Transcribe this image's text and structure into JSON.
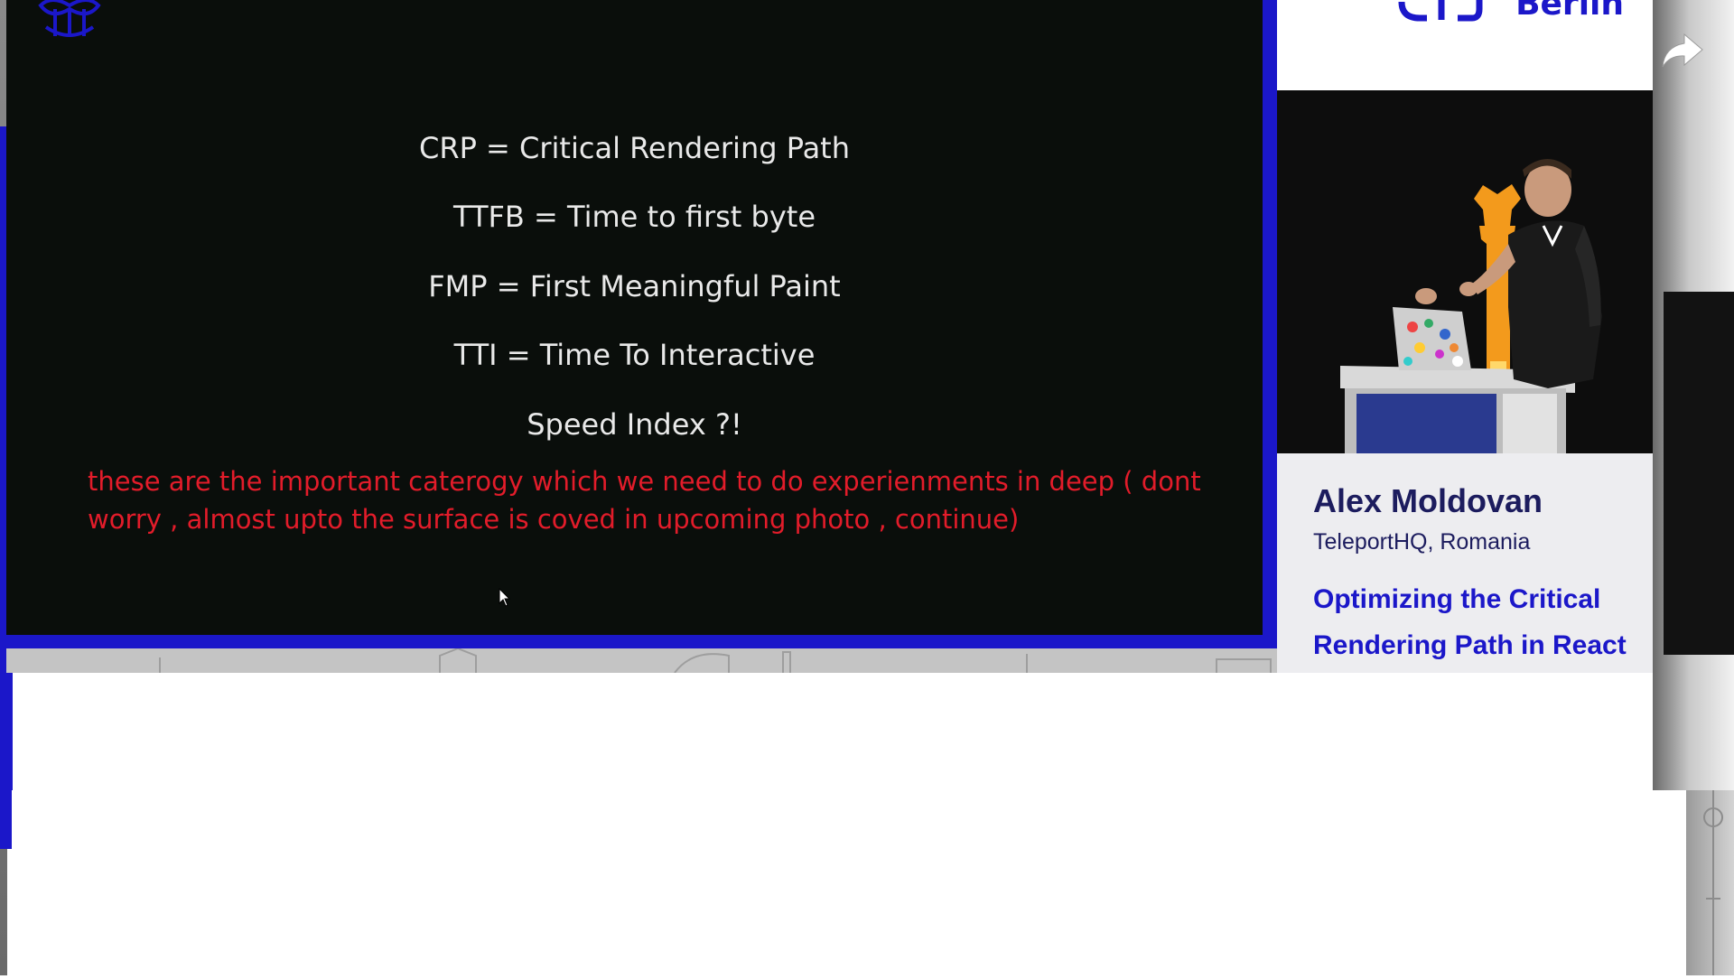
{
  "slide": {
    "lines": [
      "CRP = Critical Rendering Path",
      "TTFB = Time to first byte",
      "FMP = First Meaningful Paint",
      "TTI = Time To Interactive",
      "Speed Index ?!"
    ],
    "annotation": "these are the important caterogy which we need to do experienments in deep ( dont worry , almost upto the surface is coved in  upcoming photo , continue)"
  },
  "conference": {
    "city": "Berlin",
    "brand_color": "#1b17c9"
  },
  "speaker": {
    "name": "Alex Moldovan",
    "organization": "TeleportHQ, Romania",
    "talk_title": "Optimizing the Critical Rendering Path in React"
  },
  "controls": {
    "share_icon": "share-arrow-icon"
  },
  "colors": {
    "slide_background": "#0a0e0b",
    "slide_text": "#e9e9e9",
    "annotation_text": "#e21c2a",
    "panel_background": "#ededf0",
    "speaker_text": "#1c1c5e"
  }
}
